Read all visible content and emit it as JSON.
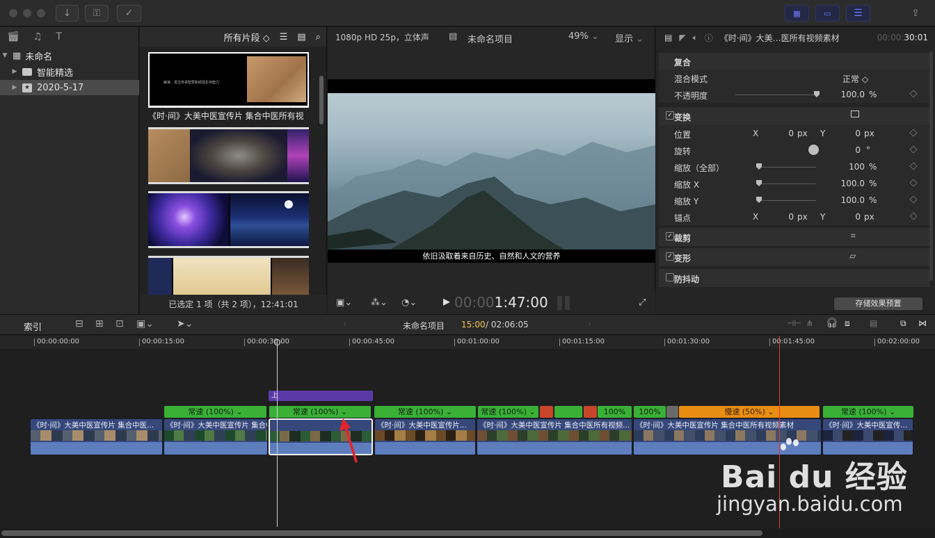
{
  "browser": {
    "filter_label": "所有片段 ◇",
    "library": {
      "name": "未命名",
      "items": [
        "智能精选",
        "2020-5-17"
      ]
    },
    "first_clip_title": "《时·间》大美中医宣传片 集合中医所有视",
    "first_clip_caption": "解读、发古传承智慧和顽强生存能力",
    "selection_status": "已选定 1 项（共 2 项），12:41:01"
  },
  "viewer": {
    "format": "1080p HD 25p，立体声",
    "project_name": "未命名项目",
    "zoom": "49%",
    "view_menu": "显示",
    "subtitle": "依旧汲取着来自历史、自然和人文的营养",
    "timecode_dim": "00:00",
    "timecode": "1:47:00"
  },
  "inspector": {
    "clip_name": "《时·间》大美…医所有视频素材",
    "duration_dim": "00:00:",
    "duration": "30:01",
    "compositing": {
      "title": "复合",
      "blend_label": "混合模式",
      "blend_value": "正常 ◇",
      "opacity_label": "不透明度",
      "opacity_value": "100.0",
      "opacity_unit": "%",
      "opacity_level": 1.0
    },
    "transform": {
      "title": "变换",
      "position_label": "位置",
      "rotation_label": "旋转",
      "scale_all_label": "缩放（全部）",
      "scale_x_label": "缩放 X",
      "scale_y_label": "缩放 Y",
      "anchor_label": "锚点",
      "x_label": "X",
      "y_label": "Y",
      "position_x": "0",
      "position_y": "0",
      "px_unit": "px",
      "rotation_value": "0",
      "rotation_unit": "°",
      "scale_all_value": "100",
      "scale_x_value": "100.0",
      "scale_y_value": "100.0",
      "pct_unit": "%",
      "anchor_x": "0",
      "anchor_y": "0"
    },
    "crop_title": "裁剪",
    "distort_title": "变形",
    "stabilize_title": "防抖动",
    "save_preset_button": "存储效果预置"
  },
  "timeline": {
    "index_tab": "索引",
    "project_name": "未命名项目",
    "playhead_time": "15:00",
    "total_time": "/ 02:06:05",
    "ruler": [
      "00:00:00:00",
      "00:00:15:00",
      "00:00:30:00",
      "00:00:45:00",
      "00:01:00:00",
      "00:01:15:00",
      "00:01:30:00",
      "00:01:45:00",
      "00:02:00:00"
    ],
    "connected_title_label": "上",
    "speed_labels": {
      "normal": "常速 (100%) ⌄",
      "short100": "100%",
      "slow": "慢速 (50%) ⌄"
    },
    "clip_names": {
      "c1": "《时·间》大美中医宣传片 集合中医...",
      "c2": "《时·间》大美中医宣传片 集合中医所有视频素材",
      "c3": "《时·间》大美中医宣传片...",
      "c4": "《时·间》大美中医宣传片 集合中医所有视频...",
      "c5": "《时·间》大美中医宣传片 集合中医所有视频素材",
      "c6": "《时·间》大美中医宣传..."
    }
  },
  "watermark": {
    "brand": "Bai du 经验",
    "url": "jingyan.baidu.com"
  },
  "colors": {
    "speed_normal": "#3ab037",
    "speed_slow": "#e98d12",
    "clip": "#36487a",
    "playhead": "#e0392b",
    "title_clip": "#5b3aa8"
  }
}
